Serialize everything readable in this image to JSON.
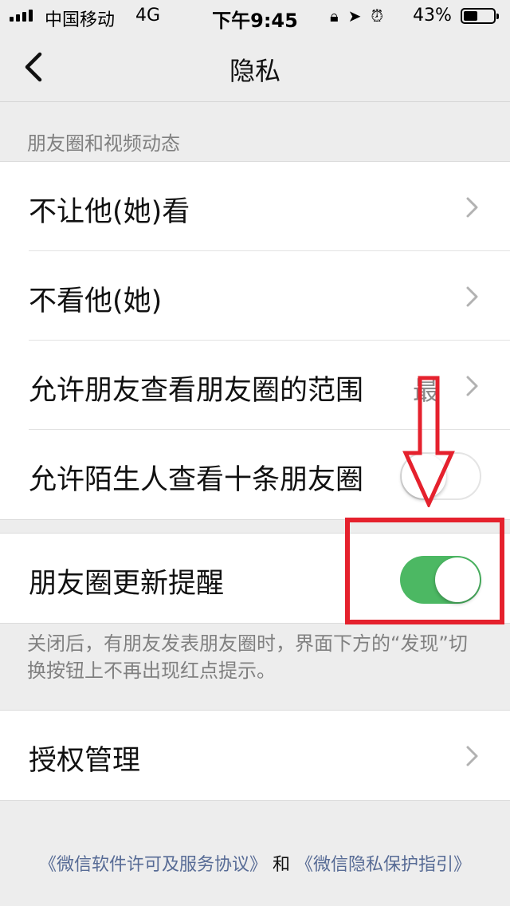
{
  "status_bar": {
    "carrier": "中国移动",
    "network": "4G",
    "time": "下午9:45",
    "battery_percent": "43%",
    "icons": [
      "orientation-lock-icon",
      "location-icon",
      "alarm-icon"
    ],
    "battery_level": 0.43
  },
  "nav": {
    "title": "隐私",
    "back_icon": "chevron-left-icon"
  },
  "moments_section": {
    "header": "朋友圈和视频动态",
    "rows": [
      {
        "label": "不让他(她)看",
        "type": "link"
      },
      {
        "label": "不看他(她)",
        "type": "link"
      },
      {
        "label": "允许朋友查看朋友圈的范围",
        "type": "link",
        "value": "最"
      },
      {
        "label": "允许陌生人查看十条朋友圈",
        "type": "toggle",
        "on": false
      }
    ]
  },
  "update_reminder": {
    "label": "朋友圈更新提醒",
    "on": true,
    "footnote": "关闭后，有朋友发表朋友圈时，界面下方的“发现”切换按钮上不再出现红点提示。"
  },
  "auth": {
    "label": "授权管理"
  },
  "footer": {
    "link1": "《微信软件许可及服务协议》",
    "conj": "和",
    "link2": "《微信隐私保护指引》"
  },
  "colors": {
    "toggle_on": "#4cb863",
    "annotation": "#e5212d",
    "link": "#576b95"
  }
}
